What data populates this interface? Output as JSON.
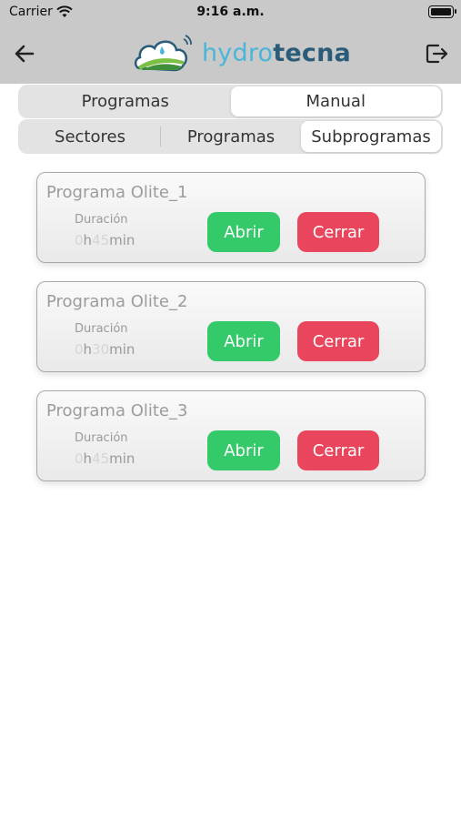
{
  "status_bar": {
    "carrier": "Carrier",
    "time": "9:16 a.m.",
    "icons": [
      "wifi-icon",
      "battery-icon"
    ]
  },
  "nav": {
    "back_icon": "arrow-left-icon",
    "logout_icon": "logout-icon",
    "logo": {
      "text_part1": "hydro",
      "text_part2": "tecna",
      "colors": [
        "#49b6d9",
        "#2a5b78",
        "#7bbf44"
      ]
    }
  },
  "top_tabs": [
    {
      "label": "Programas",
      "active": false
    },
    {
      "label": "Manual",
      "active": true
    }
  ],
  "sub_tabs": [
    {
      "label": "Sectores",
      "active": false
    },
    {
      "label": "Programas",
      "active": false
    },
    {
      "label": "Subprogramas",
      "active": true
    }
  ],
  "programs": [
    {
      "name": "Programa Olite_1",
      "duration_label": "Duración",
      "hours": "0",
      "hours_unit": "h",
      "minutes": "45",
      "minutes_unit": "min",
      "open_label": "Abrir",
      "close_label": "Cerrar"
    },
    {
      "name": "Programa Olite_2",
      "duration_label": "Duración",
      "hours": "0",
      "hours_unit": "h",
      "minutes": "30",
      "minutes_unit": "min",
      "open_label": "Abrir",
      "close_label": "Cerrar"
    },
    {
      "name": "Programa Olite_3",
      "duration_label": "Duración",
      "hours": "0",
      "hours_unit": "h",
      "minutes": "45",
      "minutes_unit": "min",
      "open_label": "Abrir",
      "close_label": "Cerrar"
    }
  ],
  "colors": {
    "header_bg": "#c9c9c9",
    "open_button": "#34c969",
    "close_button": "#e9455c"
  }
}
